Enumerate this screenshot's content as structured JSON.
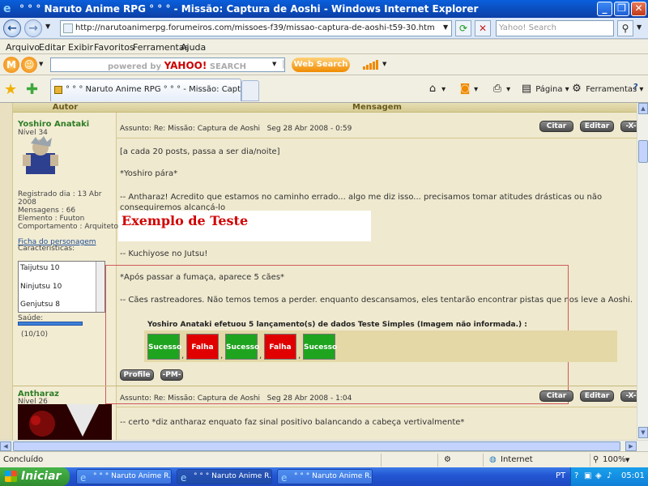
{
  "window": {
    "title": "° ° ° Naruto Anime RPG ° ° ° - Missão: Captura de Aoshi - Windows Internet Explorer"
  },
  "address_bar": {
    "url": "http://narutoanimerpg.forumeiros.com/missoes-f39/missao-captura-de-aoshi-t59-30.htm",
    "search_placeholder": "Yahoo! Search"
  },
  "menu": {
    "items": [
      "Arquivo",
      "Editar",
      "Exibir",
      "Favoritos",
      "Ferramentas",
      "Ajuda"
    ]
  },
  "yahoo_toolbar": {
    "search_placeholder_prefix": "powered by",
    "search_placeholder_brand": "YAHOO!",
    "search_placeholder_suffix": "SEARCH",
    "web_search_label": "Web Search"
  },
  "tabs": {
    "active_tab": "° ° ° Naruto Anime RPG ° ° ° - Missão: Captura de Aoshi",
    "pagina_label": "Página",
    "ferramentas_label": "Ferramentas"
  },
  "forum": {
    "col_author": "Autor",
    "col_message": "Mensagem",
    "post1": {
      "author": "Yoshiro Anataki",
      "level": "Nível 34",
      "registered": "Registrado dia : 13 Abr 2008",
      "messages": "Mensagens : 66",
      "element": "Elemento : Fuuton",
      "behavior": "Comportamento : Arquiteto",
      "sheet_link": "Ficha do personagem",
      "characteristics": "Características:",
      "skills": [
        "Taijutsu 10",
        "Ninjutsu 10",
        "Genjutsu 8"
      ],
      "health_label": "Saúde:",
      "health_value": "(10/10)",
      "health_fraction": 1.0,
      "subject": "Assunto: Re: Missão: Captura de Aoshi",
      "date": "Seg 28 Abr 2008 - 0:59",
      "btn_quote": "Citar",
      "btn_edit": "Editar",
      "btn_delete": "-X-",
      "lines": [
        "[a cada 20 posts, passa a ser dia/noite]",
        "*Yoshiro pára*",
        "-- Antharaz! Acredito que estamos no caminho errado... algo me diz isso... precisamos tomar atitudes drásticas ou não",
        "conseguiremos alcançá-lo",
        "-- Kuchiyose no Jutsu!",
        "*Após passar a fumaça, aparece 5 cães*",
        "-- Cães rastreadores. Não temos temos a perder. enquanto descansamos, eles tentarão encontrar pistas que nos leve a Aoshi."
      ],
      "example_text": "Exemplo de Teste",
      "dice_title": "Yoshiro Anataki efetuou 5 lançamento(s) de dados Teste Simples (Imagem não informada.) :",
      "dice": [
        "Sucesso",
        "Falha",
        "Sucesso",
        "Falha",
        "Sucesso"
      ],
      "btn_profile": "Profile",
      "btn_pm": "-PM-"
    },
    "post2": {
      "author": "Antharaz",
      "level": "Nível 26",
      "subject": "Assunto: Re: Missão: Captura de Aoshi",
      "date": "Seg 28 Abr 2008 - 1:04",
      "btn_quote": "Citar",
      "btn_edit": "Editar",
      "btn_delete": "-X-",
      "first_line": "-- certo *diz antharaz enquato faz sinal positivo balancando a cabeça vertivalmente*"
    }
  },
  "status_bar": {
    "status": "Concluído",
    "zone": "Internet",
    "zoom": "100%"
  },
  "taskbar": {
    "start_label": "Iniciar",
    "tasks": [
      "° ° ° Naruto Anime R...",
      "° ° ° Naruto Anime R...",
      "° ° ° Naruto Anime R..."
    ],
    "lang": "PT",
    "clock": "05:01"
  },
  "colors": {
    "success": "#1ea41e",
    "fail": "#e00000",
    "username": "#2e7d25",
    "accent_red": "#d10000"
  }
}
